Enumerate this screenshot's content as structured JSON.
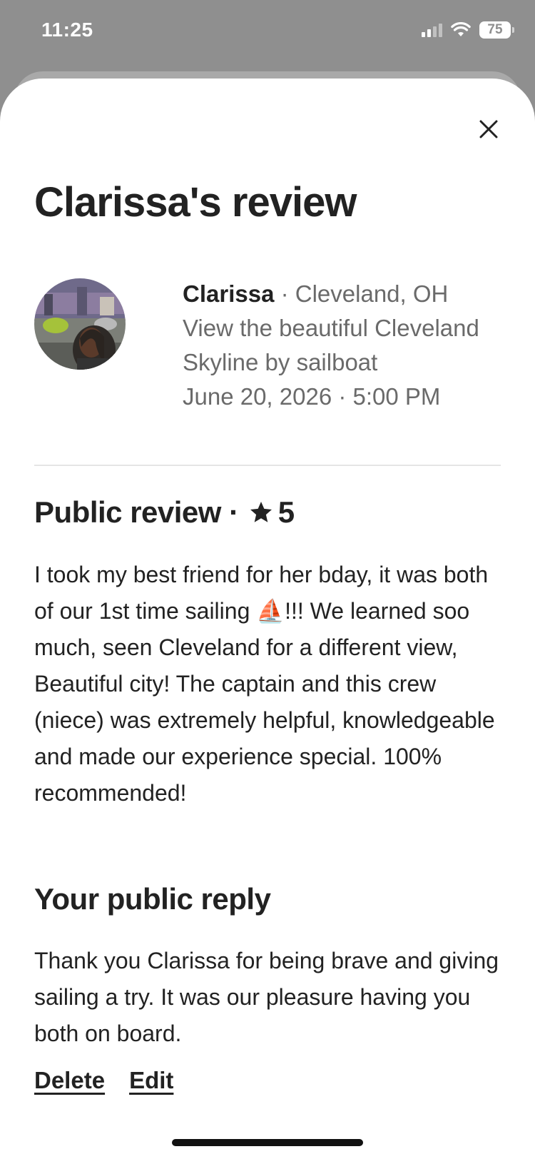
{
  "status_bar": {
    "time": "11:25",
    "battery": "75",
    "icons": [
      "cellular-signal-icon",
      "wifi-icon",
      "battery-icon"
    ]
  },
  "sheet": {
    "close_icon": "close-icon",
    "title": "Clarissa's review"
  },
  "reviewer": {
    "name": "Clarissa",
    "separator": " · ",
    "location": "Cleveland, OH",
    "experience_line1": "View the beautiful Cleveland",
    "experience_line2": "Skyline by sailboat",
    "datetime": "June 20, 2026 · 5:00 PM"
  },
  "public_review": {
    "heading": "Public review",
    "separator": " · ",
    "star_icon": "star-icon",
    "rating": "5",
    "text": "I took my best friend for her bday, it was both of our 1st time sailing ⛵!!! We learned soo much, seen Cleveland for a different view, Beautiful city! The captain and this crew (niece) was extremely helpful, knowledgeable and made our experience special. 100% recommended!"
  },
  "public_reply": {
    "heading": "Your public reply",
    "text": "Thank you Clarissa for being brave and giving sailing a try. It was our pleasure having you both on board.",
    "delete_label": "Delete",
    "edit_label": "Edit"
  },
  "colors": {
    "primary_text": "#222222",
    "secondary_text": "#6a6a6a",
    "divider": "#e5e5e5",
    "backdrop": "#8f8f8f"
  }
}
